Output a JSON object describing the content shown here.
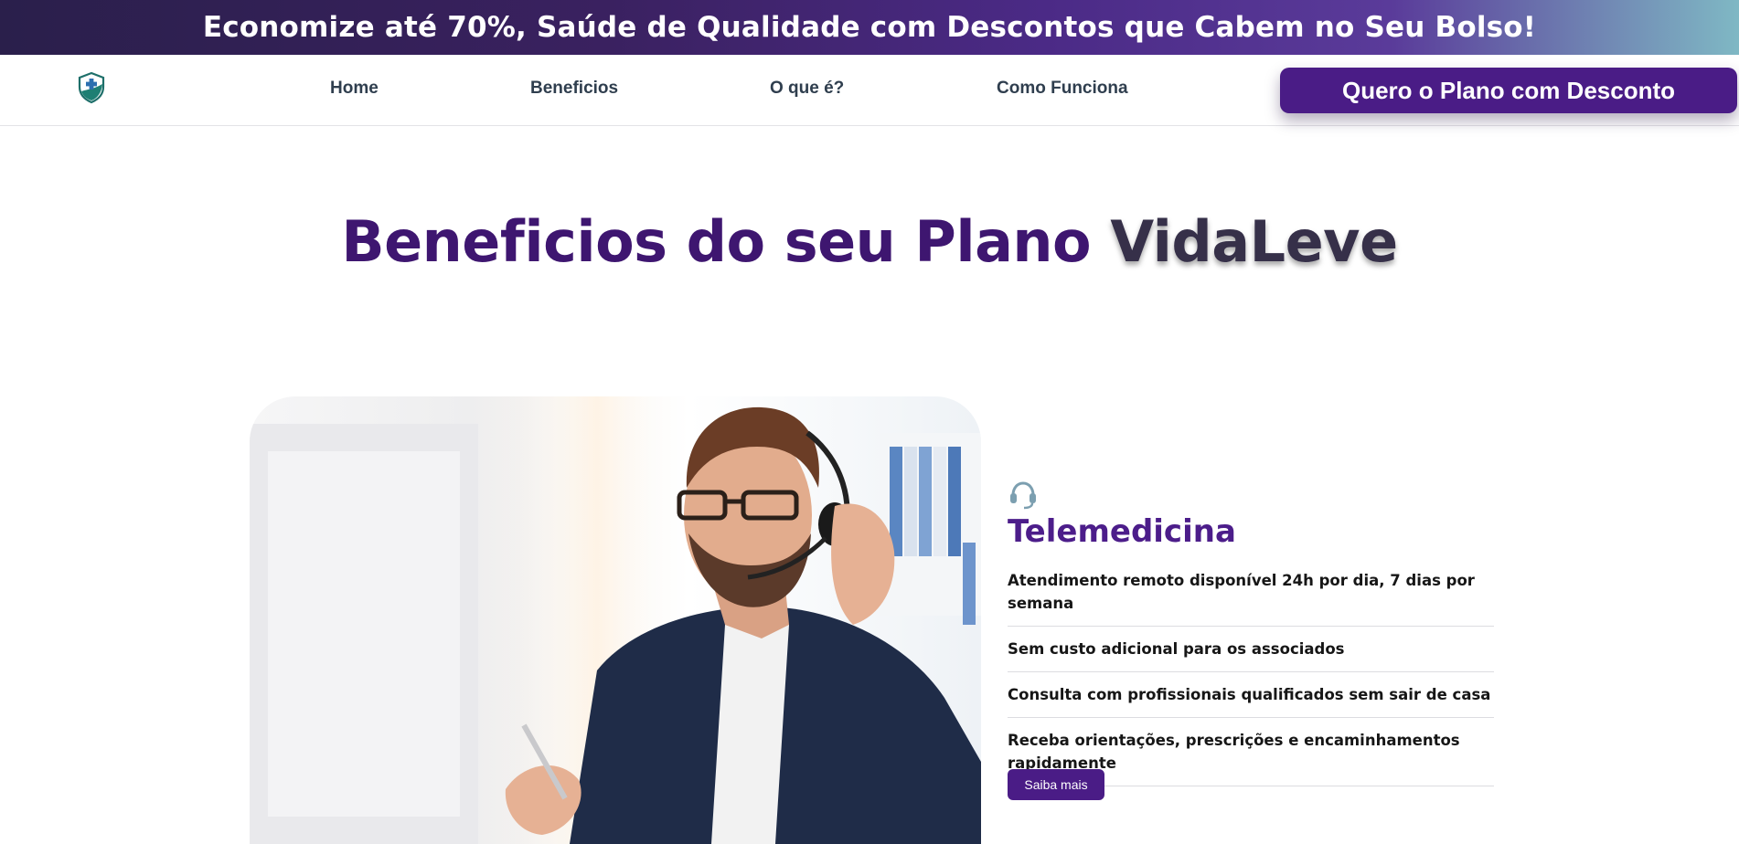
{
  "promo": {
    "text": "Economize até 70%, Saúde de Qualidade com Descontos que Cabem no Seu Bolso!"
  },
  "nav": {
    "logo_icon": "medical-shield-icon",
    "links": [
      "Home",
      "Beneficios",
      "O que é?",
      "Como Funciona"
    ],
    "cta_label": "Quero o Plano com Desconto"
  },
  "section": {
    "title_part1": "Beneficios do seu Plano",
    "title_part2": "VidaLeve"
  },
  "feature": {
    "icon": "headset-icon",
    "title": "Telemedicina",
    "items": [
      "Atendimento remoto disponível 24h por dia, 7 dias por semana",
      "Sem custo adicional para os associados",
      "Consulta com profissionais qualificados sem sair de casa",
      "Receba orientações, prescrições e encaminhamentos rapidamente"
    ],
    "button_label": "Saiba mais"
  },
  "colors": {
    "brand_purple": "#4a1c86",
    "title_purple": "#3e1670",
    "nav_text": "#2f3e4e"
  }
}
